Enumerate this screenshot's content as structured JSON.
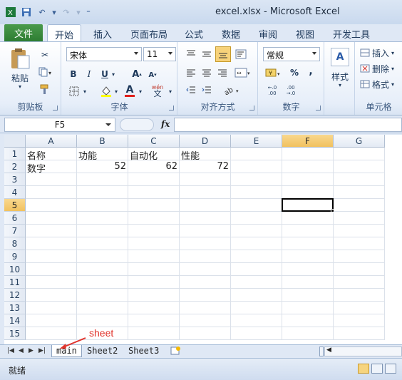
{
  "window": {
    "title": "excel.xlsx  -  Microsoft Excel"
  },
  "ribbon_tabs": [
    "文件",
    "开始",
    "插入",
    "页面布局",
    "公式",
    "数据",
    "审阅",
    "视图",
    "开发工具"
  ],
  "clipboard": {
    "paste": "粘贴",
    "label": "剪贴板"
  },
  "font": {
    "name": "宋体",
    "size": "11",
    "bold": "B",
    "italic": "I",
    "underline": "U",
    "grow": "A",
    "shrink": "A",
    "fontcolor": "A",
    "phonetic": "wén",
    "label": "字体"
  },
  "alignment": {
    "label": "对齐方式"
  },
  "number": {
    "format": "常规",
    "percent": "%",
    "comma": ",",
    "label": "数字"
  },
  "styles": {
    "label": "样式"
  },
  "cells": {
    "insert": "插入",
    "delete": "删除",
    "format": "格式",
    "label": "单元格"
  },
  "formula_bar": {
    "name_box": "F5",
    "fx": "fx",
    "content": ""
  },
  "columns": [
    "A",
    "B",
    "C",
    "D",
    "E",
    "F",
    "G"
  ],
  "rows": [
    "1",
    "2",
    "3",
    "4",
    "5",
    "6",
    "7",
    "8",
    "9",
    "10",
    "11",
    "12",
    "13",
    "14",
    "15"
  ],
  "cells_data": {
    "A1": "名称",
    "B1": "功能",
    "C1": "自动化",
    "D1": "性能",
    "A2": "数字",
    "B2": "52",
    "C2": "62",
    "D2": "72"
  },
  "selected_cell": "F5",
  "sheets": [
    "main",
    "Sheet2",
    "Sheet3"
  ],
  "active_sheet": "main",
  "annotation": "sheet",
  "status": {
    "ready": "就绪"
  }
}
